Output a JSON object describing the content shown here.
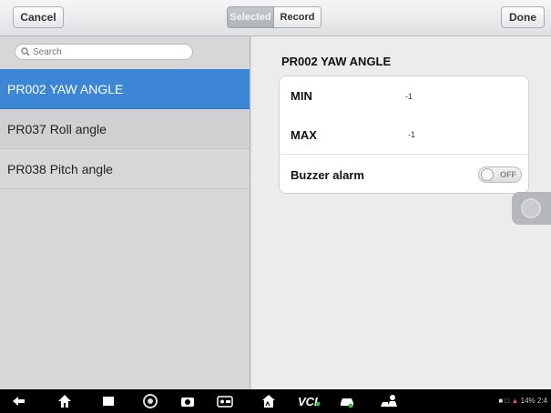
{
  "toolbar": {
    "cancel_label": "Cancel",
    "selected_label": "Selected",
    "record_label": "Record",
    "done_label": "Done"
  },
  "search": {
    "placeholder": "Search"
  },
  "list": {
    "items": [
      {
        "label": "PR002  YAW ANGLE"
      },
      {
        "label": "PR037  Roll angle"
      },
      {
        "label": "PR038  Pitch angle"
      }
    ]
  },
  "detail": {
    "title": "PR002  YAW ANGLE",
    "min_label": "MIN",
    "min_value": "-1",
    "max_label": "MAX",
    "max_value": "-1",
    "buzzer_label": "Buzzer alarm",
    "buzzer_state": "OFF"
  },
  "statusbar": {
    "text": "14% 2:4"
  },
  "colors": {
    "accent": "#3d86d6"
  },
  "icons": [
    "back-icon",
    "home-icon",
    "recent-apps-icon",
    "browser-icon",
    "camera-icon",
    "screenshot-icon",
    "autel-home-icon",
    "vci-icon",
    "car-icon",
    "service-icon"
  ]
}
